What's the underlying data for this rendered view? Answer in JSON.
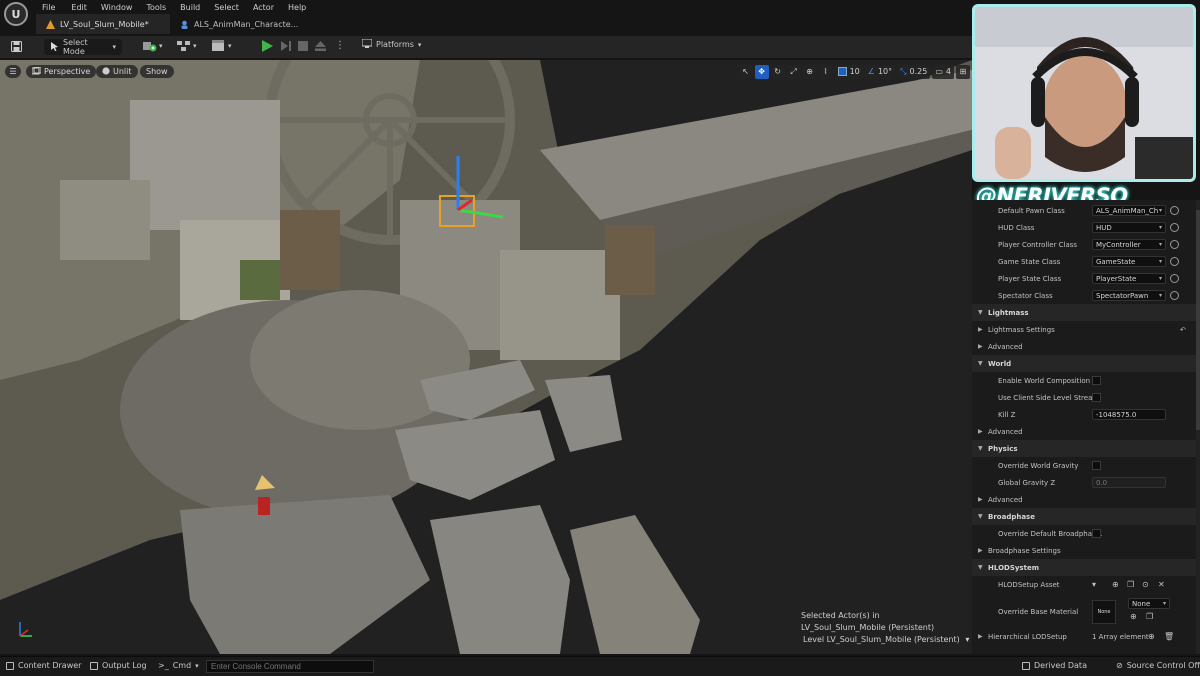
{
  "menu": [
    "File",
    "Edit",
    "Window",
    "Tools",
    "Build",
    "Select",
    "Actor",
    "Help"
  ],
  "tabs": [
    {
      "label": "LV_Soul_Slum_Mobile*",
      "active": true
    },
    {
      "label": "ALS_AnimMan_Characte...",
      "active": false
    }
  ],
  "toolbar": {
    "select_mode": "Select Mode",
    "platforms": "Platforms"
  },
  "viewport": {
    "perspective": "Perspective",
    "lit_mode": "Unlit",
    "show": "Show",
    "grid_snap": "10",
    "rot_snap": "10°",
    "scale_snap": "0.25",
    "camera_speed": "4",
    "selected_line1": "Selected Actor(s) in",
    "selected_line2": "LV_Soul_Slum_Mobile (Persistent)",
    "level_label": "Level",
    "level_name": "LV_Soul_Slum_Mobile (Persistent)"
  },
  "watermark": "@NERIVERSO",
  "details": {
    "rows": [
      {
        "label": "Default Pawn Class",
        "value": "ALS_AnimMan_Ch",
        "kind": "dropdown"
      },
      {
        "label": "HUD Class",
        "value": "HUD",
        "kind": "dropdown"
      },
      {
        "label": "Player Controller Class",
        "value": "MyController",
        "kind": "dropdown"
      },
      {
        "label": "Game State Class",
        "value": "GameState",
        "kind": "dropdown"
      },
      {
        "label": "Player State Class",
        "value": "PlayerState",
        "kind": "dropdown"
      },
      {
        "label": "Spectator Class",
        "value": "SpectatorPawn",
        "kind": "dropdown"
      },
      {
        "label": "Lightmass",
        "kind": "category"
      },
      {
        "label": "Lightmass Settings",
        "kind": "expander"
      },
      {
        "label": "Advanced",
        "kind": "expander"
      },
      {
        "label": "World",
        "kind": "category"
      },
      {
        "label": "Enable World Composition",
        "kind": "check"
      },
      {
        "label": "Use Client Side Level Strea...",
        "kind": "check"
      },
      {
        "label": "Kill Z",
        "value": "-1048575.0",
        "kind": "number"
      },
      {
        "label": "Advanced",
        "kind": "expander"
      },
      {
        "label": "Physics",
        "kind": "category"
      },
      {
        "label": "Override World Gravity",
        "kind": "check"
      },
      {
        "label": "Global Gravity Z",
        "value": "0.0",
        "kind": "number-dim"
      },
      {
        "label": "Advanced",
        "kind": "expander"
      },
      {
        "label": "Broadphase",
        "kind": "category"
      },
      {
        "label": "Override Default Broadphas...",
        "kind": "check"
      },
      {
        "label": "Broadphase Settings",
        "kind": "expander"
      },
      {
        "label": "HLODSystem",
        "kind": "category"
      },
      {
        "label": "HLODSetup Asset",
        "kind": "hlod-asset"
      }
    ],
    "override_base_material": "Override Base Material",
    "none_thumb": "None",
    "none_dropdown": "None",
    "hierarchical_lod": "Hierarchical LODSetup",
    "array_elements": "1 Array element"
  },
  "statusbar": {
    "content_drawer": "Content Drawer",
    "output_log": "Output Log",
    "cmd": "Cmd",
    "console_placeholder": "Enter Console Command",
    "derived_data": "Derived Data",
    "source_control": "Source Control Off"
  }
}
